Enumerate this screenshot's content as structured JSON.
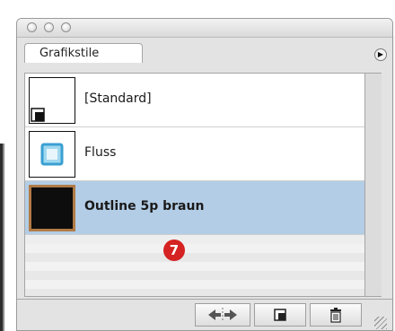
{
  "panel": {
    "tab_label": "Grafikstile",
    "menu_icon": "triangle-right-icon"
  },
  "styles": [
    {
      "label": "[Standard]",
      "selected": false
    },
    {
      "label": "Fluss",
      "selected": false
    },
    {
      "label": "Outline 5p braun",
      "selected": true
    }
  ],
  "callout": {
    "number": "7"
  },
  "toolbar": {
    "break_link_icon": "break-link-icon",
    "new_style_icon": "new-style-icon",
    "delete_icon": "trash-icon"
  },
  "colors": {
    "selection": "#b3cde6",
    "callout": "#d52222",
    "fluss_stroke": "#5ab4e0",
    "outline_fill": "#0d0d0d",
    "outline_stroke": "#b07a45"
  }
}
